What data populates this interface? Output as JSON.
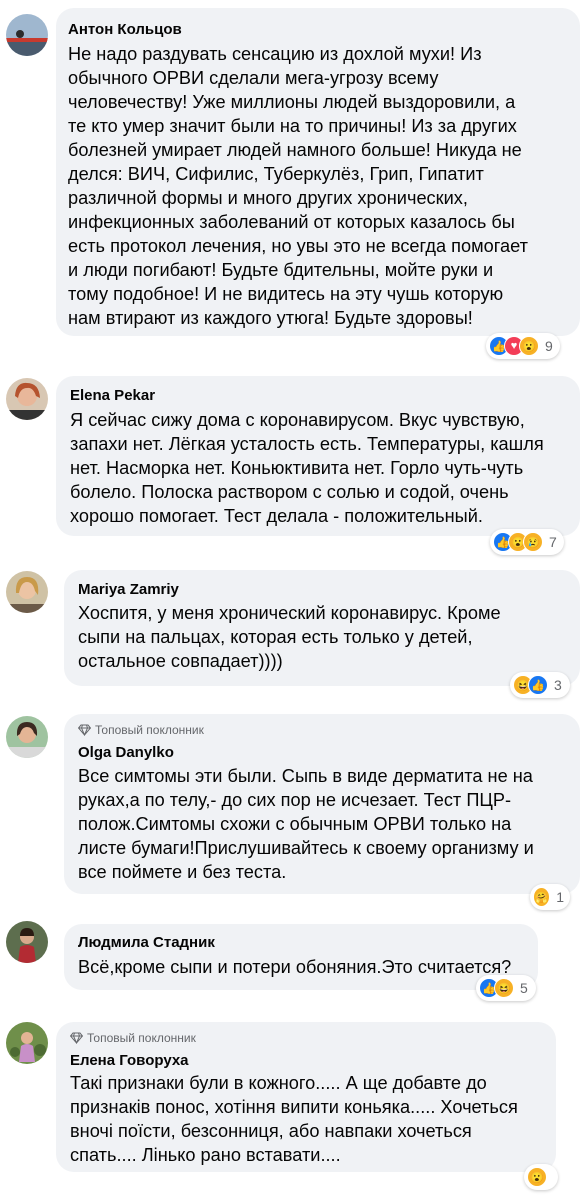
{
  "comments": [
    {
      "name": "Антон Кольцов",
      "badge": "",
      "text": "Не надо раздувать сенсацию из дохлой мухи! Из\nобычного ОРВИ сделали мега-угрозу всему\nчеловечеству! Уже миллионы людей выздоровили, а\nте кто умер значит были на то причины! Из за других\nболезней умирает людей намного больше! Никуда не\nделся: ВИЧ, Сифилис, Туберкулёз, Грип, Гипатит\nразличной формы и много других хронических,\nинфекционных заболеваний от которых казалось бы\nесть протокол лечения, но увы это не всегда помогает\nи люди погибают! Будьте бдительны, мойте руки и\nтому подобное! И не видитесь на эту чушь которую\nнам втирают из каждого утюга! Будьте здоровы!",
      "reactions": [
        "like-icon",
        "love-icon",
        "wow-icon"
      ],
      "count": "9"
    },
    {
      "name": "Elena Pekar",
      "badge": "",
      "text": "Я сейчас сижу дома с коронавирусом. Вкус чувствую,\nзапахи нет. Лёгкая усталость есть. Температуры, кашля\nнет. Насморка нет. Коньюктивита нет. Горло чуть-чуть\nболело. Полоска раствором с солью и содой, очень\nхорошо помогает. Тест делала - положительный.",
      "reactions": [
        "like-icon",
        "wow-icon",
        "sad-icon"
      ],
      "count": "7"
    },
    {
      "name": "Mariya Zamriy",
      "badge": "",
      "text": "Хоспитя, у меня хронический коронавирус. Кроме\nсыпи на пальцах, которая есть только у детей,\nостальное совпадает))))",
      "reactions": [
        "haha-icon",
        "like-icon"
      ],
      "count": "3"
    },
    {
      "name": "Olga Danylko",
      "badge": "Топовый поклонник",
      "text": "Все симтомы эти были. Сыпь в виде дерматита не на\nруках,а по телу,- до сих пор не исчезает. Тест ПЦР-\nполож.Симтомы схожи с обычным ОРВИ только на\nлисте бумаги!Прислушивайтесь к своему организму и\nвсе поймете и без теста.",
      "reactions": [
        "care-icon"
      ],
      "count": "1"
    },
    {
      "name": "Людмила Стадник",
      "badge": "",
      "text": "Всё,кроме сыпи и потери обоняния.Это считается?",
      "reactions": [
        "like-icon",
        "haha-icon"
      ],
      "count": "5"
    },
    {
      "name": "Елена Говоруха",
      "badge": "Топовый поклонник",
      "text": "Такі признаки були в кожного..... А ще добавте до\nпризнаків понос, хотіння випити коньяка..... Хочеться\nвночі поїсти, безсонниця, або навпаки хочеться\nспать.... Лінько рано вставати....",
      "reactions": [
        "wow-icon"
      ],
      "count": ""
    }
  ],
  "colors": {
    "bubble": "#f0f2f5",
    "like": "#1877f2",
    "love": "#f33e58",
    "emoji": "#f7b125",
    "muted": "#65676b"
  }
}
